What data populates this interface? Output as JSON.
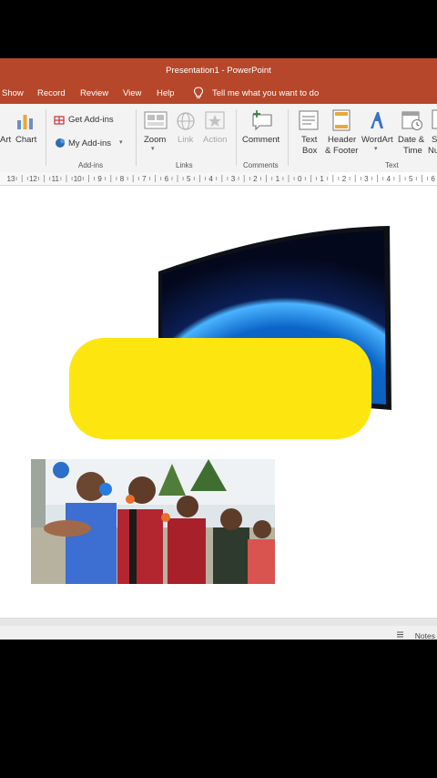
{
  "window": {
    "title": "Presentation1  -  PowerPoint"
  },
  "tabs": [
    "Show",
    "Record",
    "Review",
    "View",
    "Help"
  ],
  "tell_me": "Tell me what you want to do",
  "ribbon": {
    "art_partial": "Art",
    "chart": "Chart",
    "get_addins": "Get Add-ins",
    "my_addins": "My Add-ins",
    "addins_group": "Add-ins",
    "zoom": "Zoom",
    "link": "Link",
    "action": "Action",
    "links_group": "Links",
    "comment": "Comment",
    "comments_group": "Comments",
    "text_box_1": "Text",
    "text_box_2": "Box",
    "header_1": "Header",
    "header_2": "& Footer",
    "wordart": "WordArt",
    "date_1": "Date &",
    "date_2": "Time",
    "slide_num_partial_1": "S",
    "slide_num_partial_2": "Nu",
    "text_group": "Text"
  },
  "ruler": {
    "labels": [
      "13",
      "12",
      "11",
      "10",
      "9",
      "8",
      "7",
      "6",
      "5",
      "4",
      "3",
      "2",
      "1",
      "0",
      "1",
      "2",
      "3",
      "4",
      "5",
      "6"
    ]
  },
  "status": {
    "notes": "Notes"
  },
  "colors": {
    "accent": "#b7472a",
    "shape_fill": "#fde60f"
  },
  "icons": [
    "chart-icon",
    "store-icon",
    "addins-icon",
    "zoom-icon",
    "link-icon",
    "action-icon",
    "comment-icon",
    "textbox-icon",
    "header-footer-icon",
    "wordart-icon",
    "date-time-icon",
    "lightbulb-icon",
    "notes-icon"
  ]
}
